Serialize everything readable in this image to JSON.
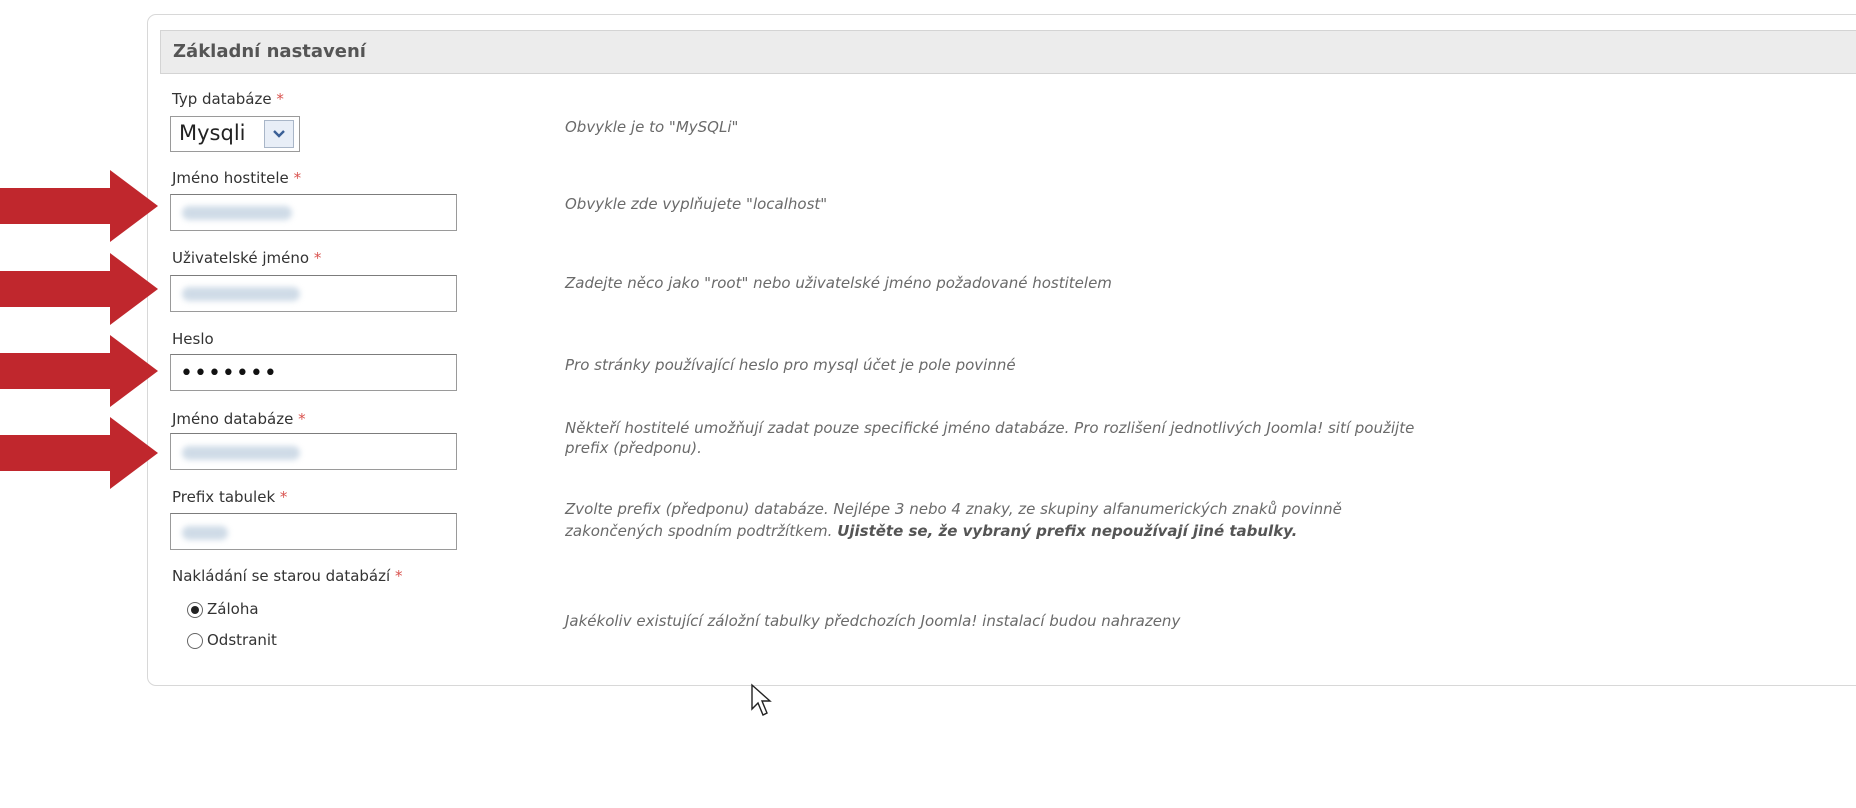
{
  "section": {
    "title": "Základní nastavení"
  },
  "fields": {
    "db_type": {
      "label": "Typ databáze",
      "required": "*",
      "value": "Mysqli",
      "hint": "Obvykle je to \"MySQLi\""
    },
    "hostname": {
      "label": "Jméno hostitele",
      "required": "*",
      "hint": "Obvykle zde vyplňujete \"localhost\""
    },
    "username": {
      "label": "Uživatelské jméno",
      "required": "*",
      "hint": "Zadejte něco jako \"root\" nebo uživatelské jméno požadované hostitelem"
    },
    "password": {
      "label": "Heslo",
      "masked_value": "•••••••",
      "hint": "Pro stránky používající heslo pro mysql účet je pole povinné"
    },
    "db_name": {
      "label": "Jméno databáze",
      "required": "*",
      "hint_line1": "Někteří hostitelé umožňují zadat pouze specifické jméno databáze. Pro rozlišení jednotlivých Joomla! sití použijte",
      "hint_line2": "prefix (předponu)."
    },
    "table_prefix": {
      "label": "Prefix tabulek",
      "required": "*",
      "hint_line1": "Zvolte prefix (předponu) databáze. Nejlépe 3 nebo 4 znaky, ze skupiny alfanumerických znaků povinně",
      "hint_line2": "zakončených spodním podtržítkem.",
      "hint_bold": "Ujistěte se, že vybraný prefix nepoužívají jiné tabulky."
    },
    "old_db": {
      "label": "Nakládání se starou databází",
      "required": "*",
      "options": [
        "Záloha",
        "Odstranit"
      ],
      "selected": "Záloha",
      "hint": "Jakékoliv existující záložní tabulky předchozích Joomla! instalací budou nahrazeny"
    }
  },
  "colors": {
    "arrow": "#c0272d",
    "legend_bg": "#ececec",
    "required": "#d9534f"
  },
  "icons": {
    "arrow": "red-arrow-icon",
    "select": "chevron-down-icon",
    "cursor": "mouse-pointer-icon"
  }
}
